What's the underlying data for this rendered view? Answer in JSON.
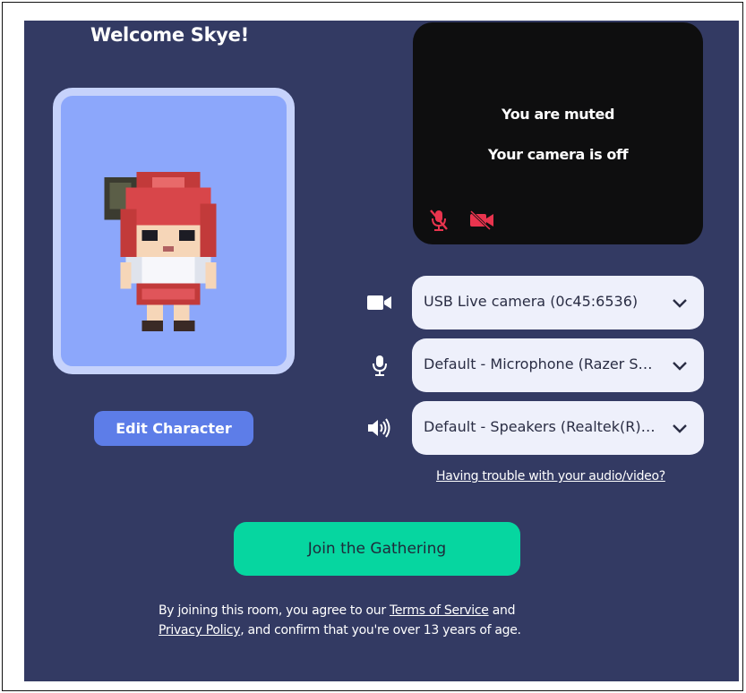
{
  "welcome": {
    "title": "Welcome Skye!"
  },
  "avatar": {
    "edit_label": "Edit Character"
  },
  "preview": {
    "muted_text": "You are muted",
    "camera_off_text": "Your camera is off"
  },
  "devices": {
    "camera": {
      "icon": "camera-icon",
      "selected": "USB Live camera (0c45:6536)"
    },
    "microphone": {
      "icon": "microphone-icon",
      "selected": "Default - Microphone (Razer Seiren Mini)"
    },
    "speakers": {
      "icon": "speaker-icon",
      "selected": "Default - Speakers (Realtek(R) Audio)"
    }
  },
  "help_link": "Having trouble with your audio/video?",
  "join_label": "Join the Gathering",
  "legal": {
    "before_terms": "By joining this room, you agree to our ",
    "terms_link": "Terms of Service",
    "and": " and ",
    "privacy_link": "Privacy Policy",
    "after_privacy": ", and confirm that you're over 13 years of age."
  },
  "colors": {
    "panel_bg": "#333a63",
    "join_green": "#06d6a0",
    "edit_blue": "#5d7de8",
    "avatar_bg": "#8ca7fb",
    "muted_red": "#e8344e"
  }
}
